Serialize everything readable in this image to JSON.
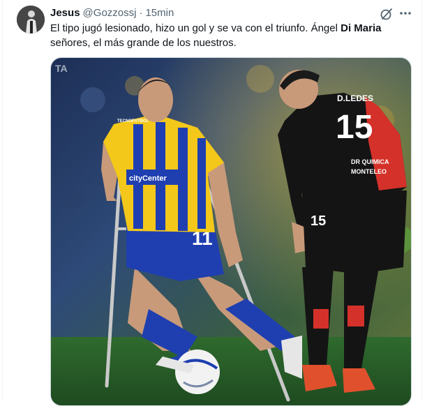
{
  "tweet": {
    "author_name": "Jesus",
    "author_handle": "@Gozzossj",
    "separator": "·",
    "time": "15min",
    "text_part1": "El tipo jugó lesionado, hizo un gol y se va con el triunfo. Ángel ",
    "text_bold": "Di Maria",
    "text_part2": " señores, el más grande de los nuestros."
  },
  "photo": {
    "watermark": "TA",
    "player_left_number": "11",
    "player_left_sponsor": "cityCenter",
    "player_left_brand": "TECNOFUTBOL",
    "player_right_number": "15",
    "player_right_name": "D.LEDES",
    "player_right_sponsor_1": "DR QUIMICA",
    "player_right_sponsor_2": "MONTELEO"
  },
  "icons": {
    "avatar": "avatar-photo",
    "grok": "grok-icon",
    "more": "more-icon"
  },
  "colors": {
    "text_primary": "#0f1419",
    "text_secondary": "#536471",
    "kit_blue": "#1f3fb0",
    "kit_yellow": "#f3c81a",
    "kit_black": "#141414",
    "kit_red": "#d4312a"
  }
}
